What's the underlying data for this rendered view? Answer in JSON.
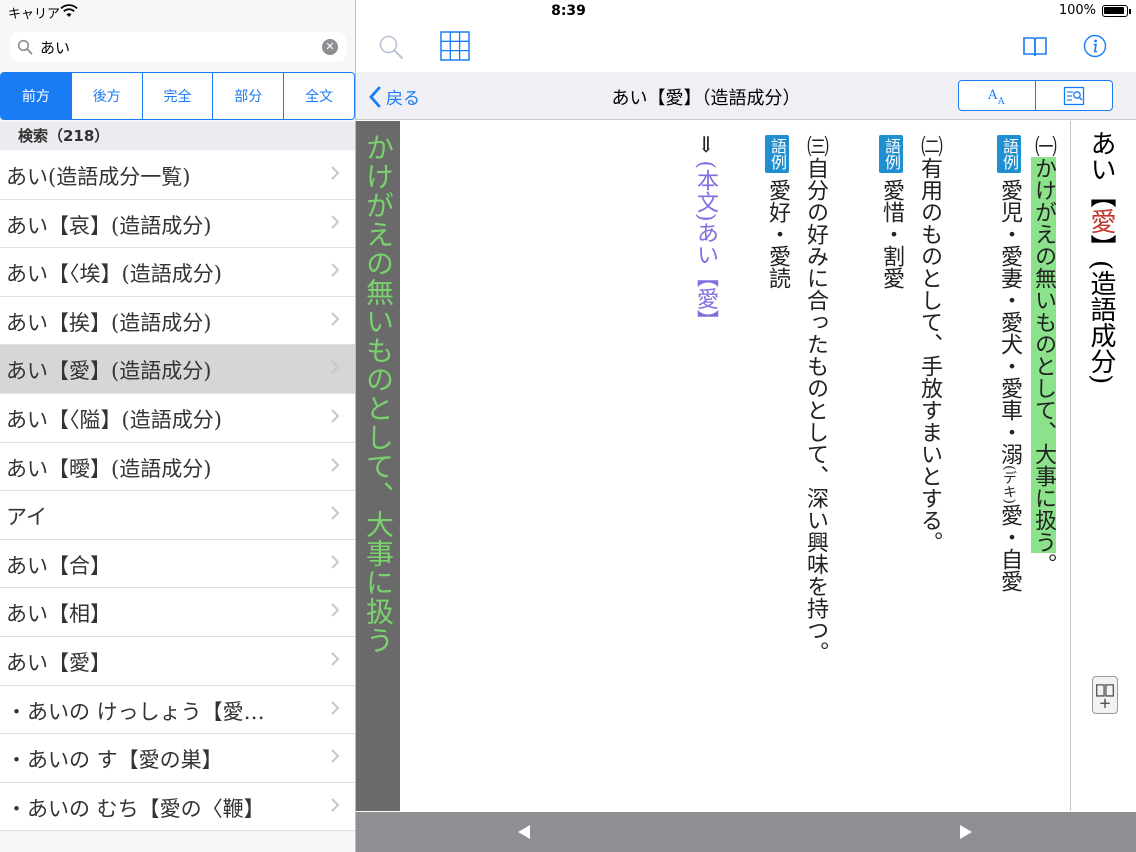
{
  "status": {
    "carrier": "キャリア",
    "time": "8:39",
    "battery": "100%"
  },
  "search": {
    "value": "あい"
  },
  "modes": [
    {
      "label": "前方",
      "active": true
    },
    {
      "label": "後方",
      "active": false
    },
    {
      "label": "完全",
      "active": false
    },
    {
      "label": "部分",
      "active": false
    },
    {
      "label": "全文",
      "active": false
    }
  ],
  "results_header": "検索（218）",
  "results": [
    {
      "label": "あい(造語成分一覧)",
      "selected": false
    },
    {
      "label": "あい【哀】(造語成分)",
      "selected": false
    },
    {
      "label": "あい【〈埃】(造語成分)",
      "selected": false
    },
    {
      "label": "あい【挨】(造語成分)",
      "selected": false
    },
    {
      "label": "あい【愛】(造語成分)",
      "selected": true
    },
    {
      "label": "あい【〈隘】(造語成分)",
      "selected": false
    },
    {
      "label": "あい【曖】(造語成分)",
      "selected": false
    },
    {
      "label": "アイ",
      "selected": false
    },
    {
      "label": "あい【合】",
      "selected": false
    },
    {
      "label": "あい【相】",
      "selected": false
    },
    {
      "label": "あい【愛】",
      "selected": false
    },
    {
      "label": "・あいの けっしょう【愛…",
      "selected": false
    },
    {
      "label": "・あいの す【愛の巣】",
      "selected": false
    },
    {
      "label": "・あいの むち【愛の〈鞭】",
      "selected": false
    }
  ],
  "nav": {
    "back_label": "戻る",
    "title": "あい【愛】（造語成分）"
  },
  "highlight_strip": "かけがえの無いものとして、大事に扱う",
  "headword": {
    "kana": "あい",
    "bracket_open": "【",
    "kanji": "愛",
    "bracket_close": "】",
    "suffix": "(造語成分)"
  },
  "entry": {
    "sense1_marker": "㈠",
    "sense1_text": "かけがえの無いものとして、大事に扱う",
    "sense1_end": "。",
    "example_badge": "語例",
    "sense1_examples": "愛児・愛妻・愛犬・愛車・溺",
    "sense1_ruby": "(デキ)",
    "sense1_examples_end": "愛・自愛",
    "sense2_marker": "㈡",
    "sense2_text": "有用のものとして、手放すまいとする。",
    "sense2_examples": "愛惜・割愛",
    "sense3_marker": "㈢",
    "sense3_text": "自分の好みに合ったものとして、深い興味を持つ。",
    "sense3_examples": "愛好・愛読",
    "crossref_arrow": "⇒",
    "crossref_text": "(本文)あい【愛】"
  },
  "icons": {
    "search": "search-icon",
    "grid": "grid-icon",
    "book": "book-icon",
    "info": "info-icon",
    "font_size": "font-size-icon",
    "lookup": "lookup-icon",
    "book_plus": "book-plus-icon"
  },
  "colors": {
    "accent": "#1a7cf5",
    "highlight": "#8be28b",
    "strip_text": "#79d26d",
    "badge": "#1f8fd0",
    "headword_kanji": "#c0392b",
    "crossref": "#7d6fe0"
  }
}
